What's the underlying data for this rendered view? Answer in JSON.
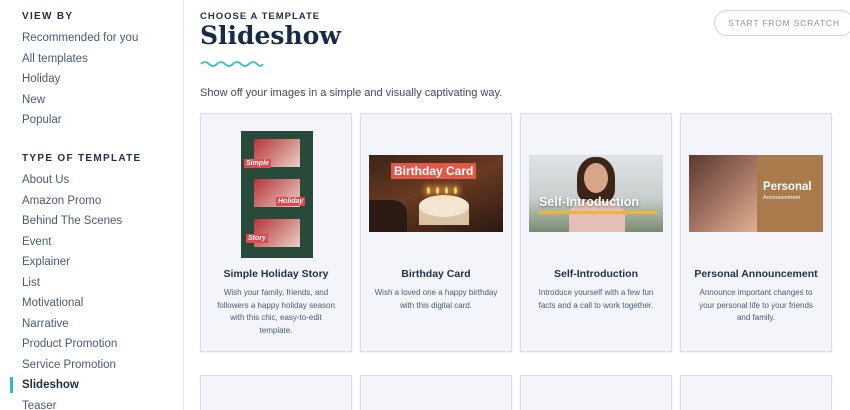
{
  "sidebar": {
    "view_by_heading": "VIEW BY",
    "view_by_items": [
      {
        "label": "Recommended for you"
      },
      {
        "label": "All templates"
      },
      {
        "label": "Holiday"
      },
      {
        "label": "New"
      },
      {
        "label": "Popular"
      }
    ],
    "type_heading": "TYPE OF TEMPLATE",
    "type_items": [
      {
        "label": "About Us"
      },
      {
        "label": "Amazon Promo"
      },
      {
        "label": "Behind The Scenes"
      },
      {
        "label": "Event"
      },
      {
        "label": "Explainer"
      },
      {
        "label": "List"
      },
      {
        "label": "Motivational"
      },
      {
        "label": "Narrative"
      },
      {
        "label": "Product Promotion"
      },
      {
        "label": "Service Promotion"
      },
      {
        "label": "Slideshow",
        "active": true
      },
      {
        "label": "Teaser"
      }
    ]
  },
  "header": {
    "kicker": "CHOOSE A TEMPLATE",
    "title": "Slideshow",
    "description": "Show off your images in a simple and visually captivating way.",
    "scratch_button": "START FROM SCRATCH"
  },
  "accent_color": "#2cbdbd",
  "cards": [
    {
      "title": "Simple Holiday Story",
      "description": "Wish your family, friends, and followers a happy holiday season with this chic, easy-to-edit template.",
      "thumb_tags": [
        "Simple",
        "Holiday",
        "Story"
      ]
    },
    {
      "title": "Birthday Card",
      "description": "Wish a loved one a happy birthday with this digital card.",
      "thumb_label": "Birthday Card"
    },
    {
      "title": "Self-Introduction",
      "description": "Introduce yourself with a few fun facts and a call to work together.",
      "thumb_label": "Self-Introduction"
    },
    {
      "title": "Personal Announcement",
      "description": "Announce important changes to your personal life to your friends and family.",
      "thumb_label": "Personal",
      "thumb_sublabel": "Announcement"
    }
  ]
}
